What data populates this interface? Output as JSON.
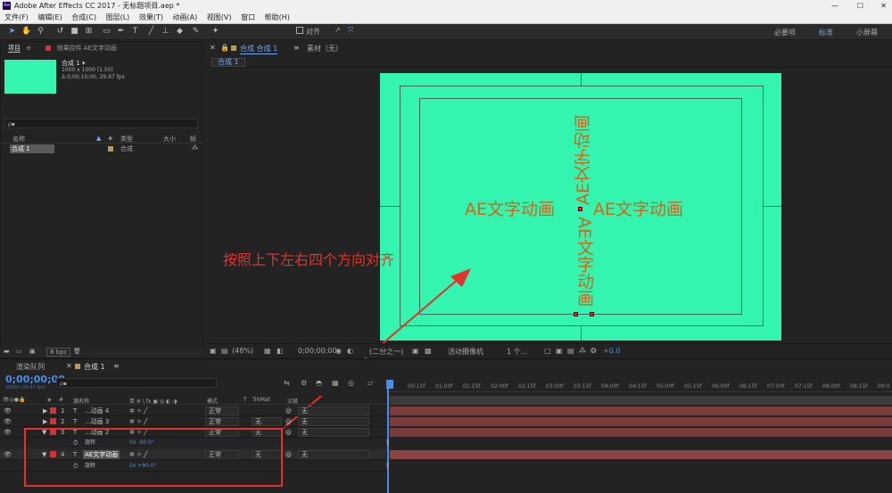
{
  "title_bar": {
    "icon": "Ae",
    "title": "Adobe After Effects CC 2017 - 无标题项目.aep *"
  },
  "menu": [
    "文件(F)",
    "编辑(E)",
    "合成(C)",
    "图层(L)",
    "效果(T)",
    "动画(A)",
    "视图(V)",
    "窗口",
    "帮助(H)"
  ],
  "toolbar": {
    "snap_label": "对齐",
    "workspaces": [
      "必要项",
      "标准",
      "小屏幕"
    ]
  },
  "project_panel": {
    "tab_project": "项目",
    "tab_effects": "效果控件 AE文字动画",
    "comp_name": "合成 1 ▾",
    "comp_info_1": "1000 x 1000 (1.50)",
    "comp_info_2": "Δ 0;00;10;00, 29.97 fps",
    "search_placeholder": "ρ▪",
    "col_name": "名称",
    "col_type": "类型",
    "col_size": "大小",
    "col_rate": "帧",
    "item_name": "合成 1",
    "item_type": "合成",
    "bpc": "8 bpc"
  },
  "comp_panel": {
    "tab_label": "合成 合成 1",
    "footage_tab": "素材（无）",
    "breadcrumb": "合成 1",
    "text_left": "AE文字动画",
    "text_right": "AE文字动画",
    "text_vertical_top": "AE文字动画",
    "text_vertical_bottom": "AE文字动画",
    "annotation": "按照上下左右四个方向对齐",
    "zoom": "(48%)",
    "timecode": "0;00;00;00",
    "resolution": "(二分之一)",
    "camera": "活动摄像机",
    "views": "1 个...",
    "exposure": "+0.0"
  },
  "timeline": {
    "tab_render": "渲染队列",
    "tab_comp": "合成 1",
    "timecode": "0;00;00;00",
    "timecode_sub": "00000 (29.97 fps)",
    "search_placeholder": "ρ▪",
    "col_num": "#",
    "col_source": "源名称",
    "col_switches": "单 ✲ \\ fx ▣ ◎ ◐ ◑",
    "col_mode": "模式",
    "col_t": "T",
    "col_trkmat": "TrkMat",
    "col_parent": "父级",
    "ruler_ticks": [
      "00:15f",
      "01:00f",
      "01:15f",
      "02:00f",
      "02:15f",
      "03:00f",
      "03:15f",
      "04:00f",
      "04:15f",
      "05:00f",
      "05:15f",
      "06:00f",
      "06:15f",
      "07:00f",
      "07:15f",
      "08:00f",
      "08:15f",
      "09:0"
    ],
    "layers": [
      {
        "num": "1",
        "name": "...动画 4",
        "mode": "正常",
        "trkmat": "",
        "parent": "无"
      },
      {
        "num": "2",
        "name": "...动画 3",
        "mode": "正常",
        "trkmat": "无",
        "parent": "无"
      },
      {
        "num": "3",
        "name": "...动画 2",
        "mode": "正常",
        "trkmat": "无",
        "parent": "无",
        "prop": "旋转",
        "prop_value": "0x -90.0°"
      },
      {
        "num": "4",
        "name": "AE文字动画",
        "mode": "正常",
        "trkmat": "无",
        "parent": "无",
        "prop": "旋转",
        "prop_value": "0x +90.0°"
      }
    ]
  },
  "colors": {
    "canvas": "#33f5b0",
    "text": "#d0661c",
    "annotation": "#e4312b",
    "label": "#c8373d",
    "timecode": "#4a8de8"
  }
}
